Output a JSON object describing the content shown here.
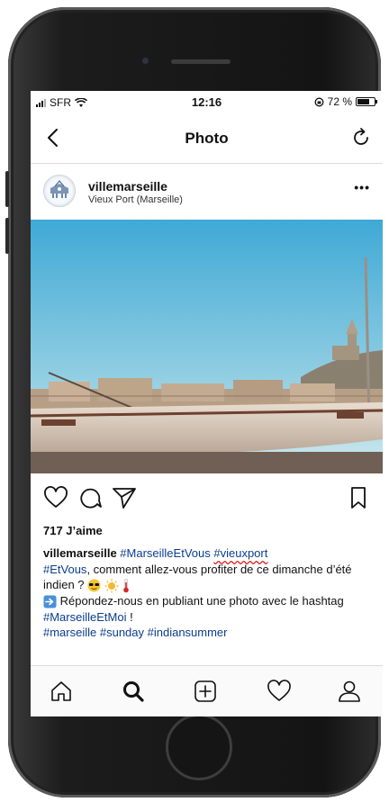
{
  "status": {
    "carrier": "SFR",
    "time": "12:16",
    "battery": "72 %",
    "battery_level": 0.72
  },
  "nav": {
    "title": "Photo",
    "back_icon": "chevron-left-icon",
    "refresh_icon": "refresh-icon"
  },
  "post": {
    "username": "villemarseille",
    "location": "Vieux Port (Marseille)",
    "more": "•••",
    "likes": "717 J’aime",
    "caption_user": "villemarseille",
    "caption_tag1": "#MarseilleEtVous",
    "caption_tag2": "#vieuxport",
    "caption_tag3": "#EtVous",
    "caption_text1": ", comment allez-vous profiter de ce dimanche d’été indien ?",
    "caption_text2": "Répondez-nous en publiant une photo avec le hashtag",
    "caption_tag4": "#MarseilleEtMoi",
    "caption_text3": "!",
    "caption_tags_end": "#marseille #sunday #indiansummer"
  },
  "colors": {
    "hashtag": "#0a3d8f",
    "sky_top": "#3fa9d6",
    "sky_bottom": "#bfe3ee"
  }
}
